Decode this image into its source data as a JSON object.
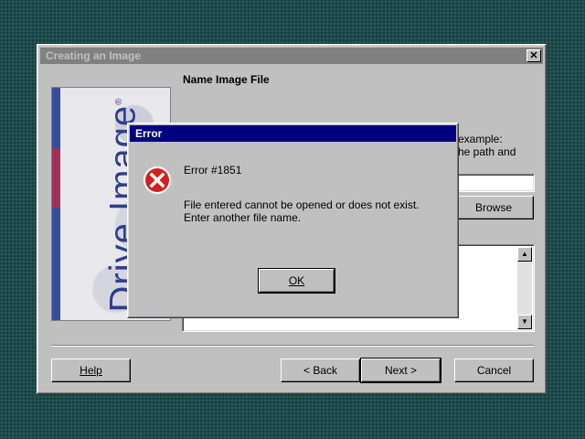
{
  "wizard": {
    "title": "Creating an Image",
    "close_label": "✕",
    "side_image_text": "Drive Image",
    "side_image_mark": "®",
    "heading": "Name Image File",
    "description_line_1": "example:",
    "description_line_2": "he path and",
    "file_input_value": "",
    "browse_label": "Browse",
    "help_label": "Help",
    "back_label": "< Back",
    "next_label": "Next >",
    "cancel_label": "Cancel"
  },
  "error_dialog": {
    "title": "Error",
    "icon": "error-x-icon",
    "code": "Error #1851",
    "message_line_1": "File entered cannot be opened or does not exist.",
    "message_line_2": "Enter another file name.",
    "ok_label": "OK"
  },
  "colors": {
    "desktop": "#1e4b4b",
    "inactive_title": "#808080",
    "active_title": "#000080",
    "face": "#c0c0c0",
    "error_red": "#d42020",
    "brand_blue": "#2f3f8f"
  }
}
